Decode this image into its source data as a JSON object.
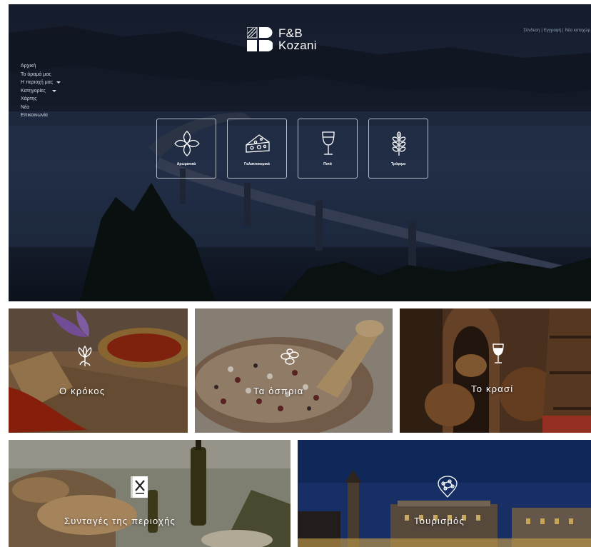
{
  "brand": {
    "line1": "F&B",
    "line2": "Kozani"
  },
  "top_links": [
    "Σύνδεση",
    "|",
    "Εγγραφή",
    "|",
    "Νέα καταχώρ"
  ],
  "nav": [
    {
      "label": "Αρχική",
      "has_dropdown": false
    },
    {
      "label": "Το όραμά μας",
      "has_dropdown": false
    },
    {
      "label": "Η περιοχή μας",
      "has_dropdown": true
    },
    {
      "label": "Κατηγορίες",
      "has_dropdown": true
    },
    {
      "label": "Χάρτης",
      "has_dropdown": false
    },
    {
      "label": "Νέα",
      "has_dropdown": false
    },
    {
      "label": "Επικοινωνία",
      "has_dropdown": false
    }
  ],
  "categories": [
    {
      "label": "Αρωματικά",
      "icon": "herb-flower-icon"
    },
    {
      "label": "Γαλακτοκομικά",
      "icon": "cheese-icon"
    },
    {
      "label": "Ποτά",
      "icon": "wine-glass-icon"
    },
    {
      "label": "Τρόφιμα",
      "icon": "wheat-icon"
    }
  ],
  "tiles": [
    {
      "title": "Ο κρόκος",
      "icon": "saffron-flower-icon"
    },
    {
      "title": "Τα όσπρια",
      "icon": "beans-icon"
    },
    {
      "title": "Το κρασί",
      "icon": "wine-glass-icon"
    },
    {
      "title": "Συνταγές της περιοχής",
      "icon": "recipe-book-icon"
    },
    {
      "title": "Τουρισμός",
      "icon": "map-pin-icon"
    }
  ],
  "colors": {
    "hero_night": "#1e2a3c",
    "text_light": "#ffffff",
    "link_muted": "#8ea0b8"
  }
}
